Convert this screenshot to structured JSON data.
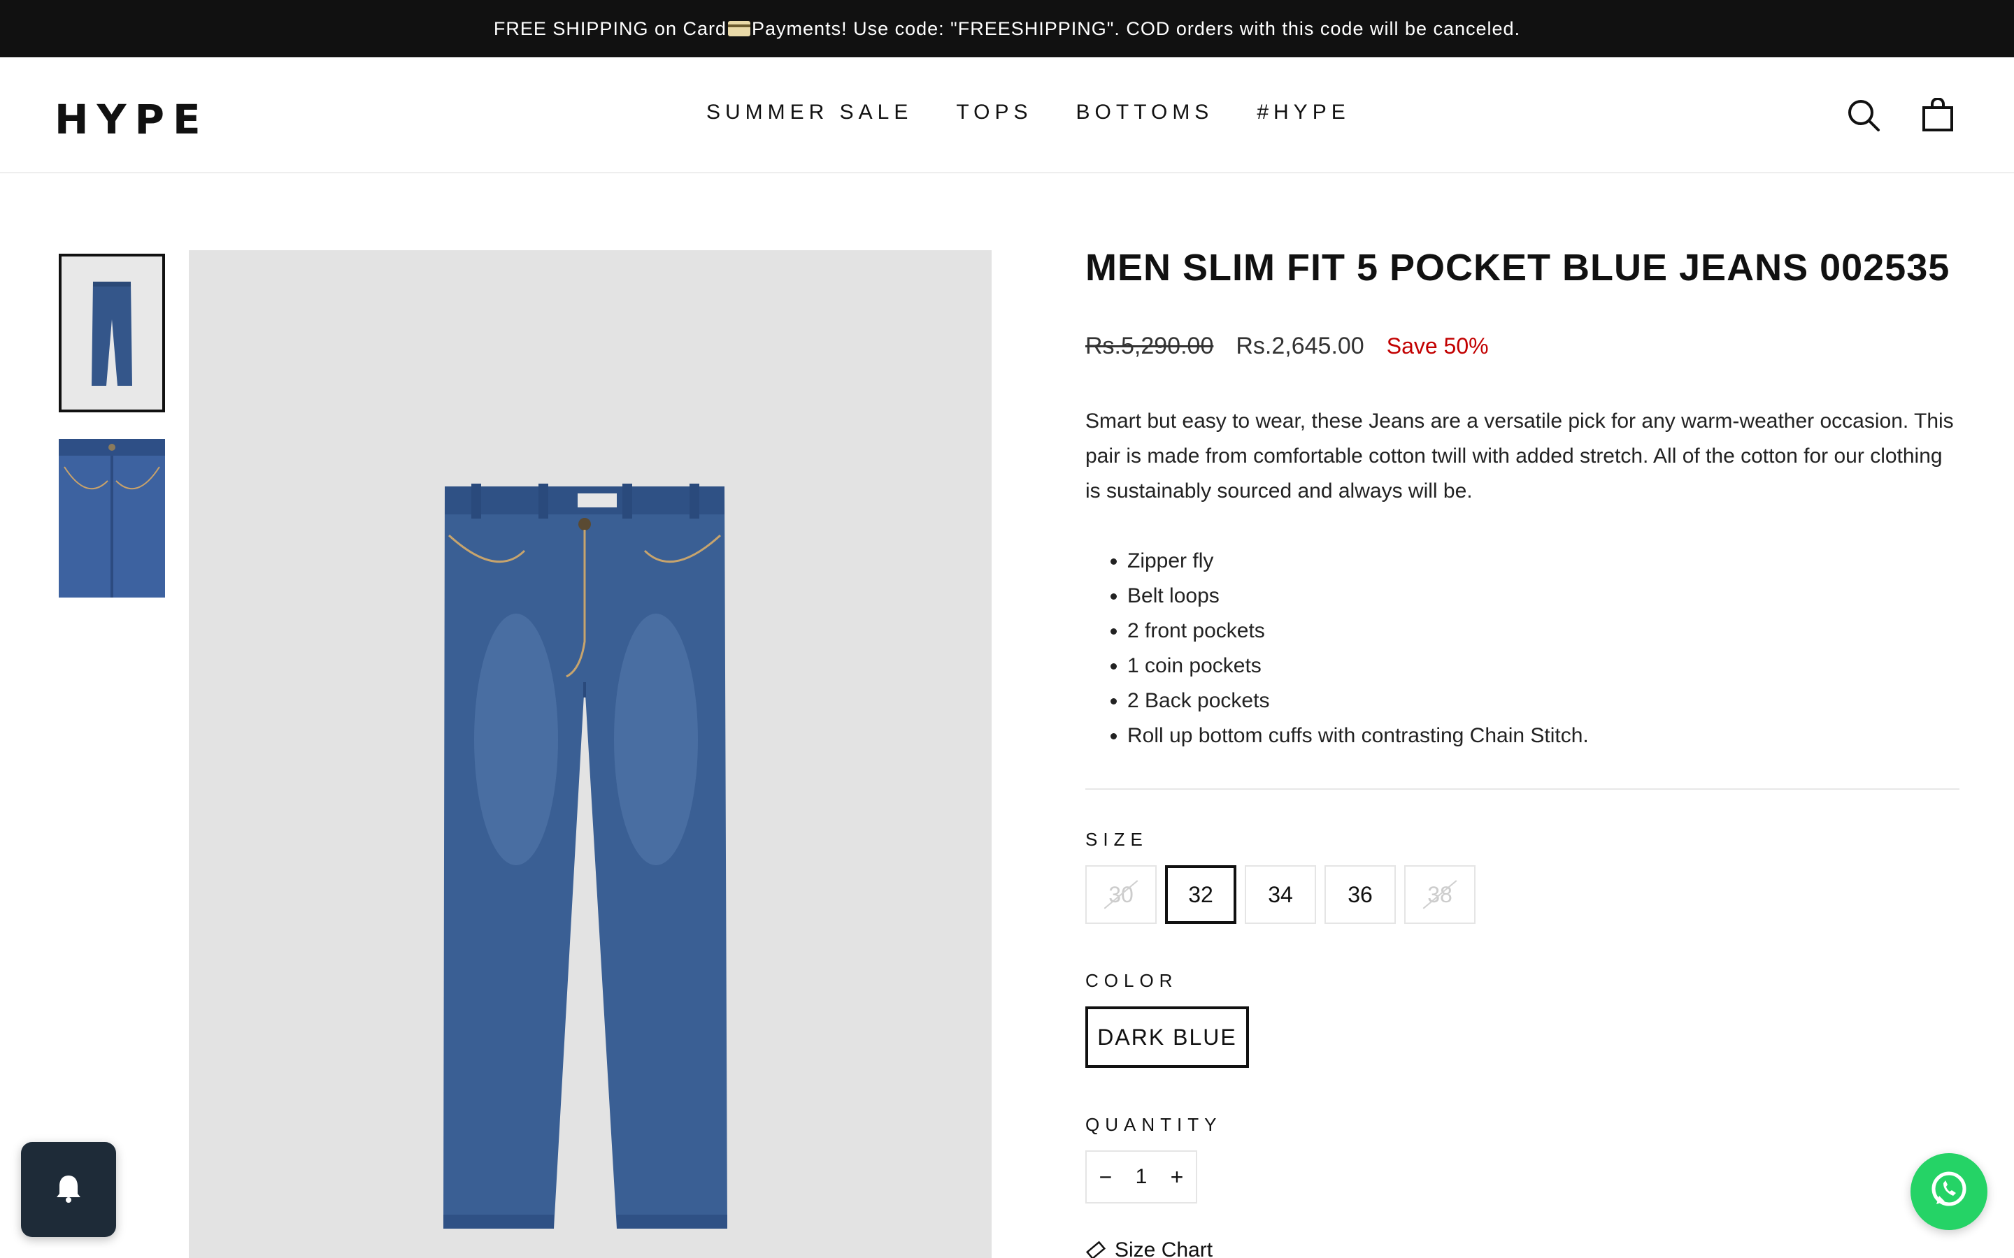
{
  "announcement": {
    "text_before": "FREE SHIPPING on Card",
    "card_icon": "credit-card-icon",
    "text_after": " Payments! Use code: \"FREESHIPPING\". COD orders with this code will be canceled."
  },
  "header": {
    "logo": "HYPE",
    "nav": [
      "SUMMER SALE",
      "TOPS",
      "BOTTOMS",
      "#HYPE"
    ],
    "search_icon": "search-icon",
    "cart_icon": "shopping-bag-icon"
  },
  "product": {
    "title": "MEN SLIM FIT 5 POCKET BLUE JEANS 002535",
    "price_original": "Rs.5,290.00",
    "price_sale": "Rs.2,645.00",
    "save_label": "Save 50%",
    "description": "Smart but easy to wear, these Jeans are a versatile pick for any warm-weather occasion. This pair is made from comfortable cotton twill with added stretch. All of the cotton for our clothing is sustainably sourced and always will be.",
    "features": [
      "Zipper fly",
      "Belt loops",
      "2 front pockets",
      "1 coin pockets",
      "2 Back pockets",
      "Roll up bottom cuffs with contrasting Chain Stitch."
    ],
    "size_label": "SIZE",
    "sizes": [
      {
        "label": "30",
        "state": "unavailable"
      },
      {
        "label": "32",
        "state": "selected"
      },
      {
        "label": "34",
        "state": "available"
      },
      {
        "label": "36",
        "state": "available"
      },
      {
        "label": "38",
        "state": "unavailable"
      }
    ],
    "color_label": "COLOR",
    "color_value": "DARK BLUE",
    "quantity_label": "QUANTITY",
    "quantity": "1",
    "qty_minus": "−",
    "qty_plus": "+",
    "size_chart_label": "Size Chart",
    "size_chart_icon": "ruler-icon"
  },
  "widgets": {
    "notification_icon": "bell-icon",
    "whatsapp_icon": "whatsapp-icon",
    "whatsapp_color": "#25d366"
  },
  "colors": {
    "announcement_bg": "#111111",
    "sale_red": "#c20000",
    "image_bg": "#e3e3e3",
    "denim": "#3a5f94"
  }
}
